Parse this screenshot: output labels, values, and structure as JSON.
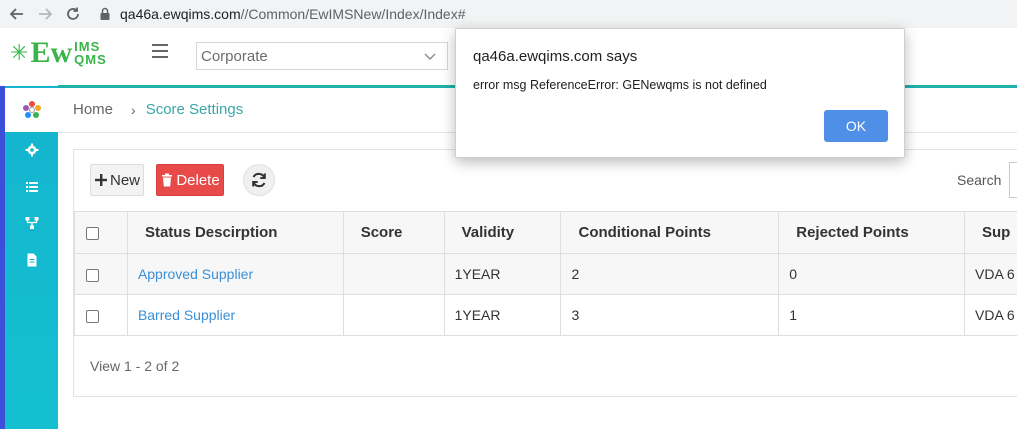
{
  "browser": {
    "url_host": "qa46a.ewqims.com",
    "url_path": "//Common/EwIMSNew/Index/Index#"
  },
  "header": {
    "logo_main": "Ew",
    "logo_top": "IMS",
    "logo_bottom": "QMS",
    "org_selected": "Corporate"
  },
  "breadcrumb": {
    "home": "Home",
    "separator": "›",
    "current": "Score Settings"
  },
  "toolbar": {
    "new_label": "New",
    "delete_label": "Delete",
    "search_label": "Search"
  },
  "table": {
    "columns": [
      "Status Descirption",
      "Score",
      "Validity",
      "Conditional Points",
      "Rejected Points",
      "Sup"
    ],
    "rows": [
      {
        "status": "Approved Supplier",
        "score": "",
        "validity": "1YEAR",
        "conditional": "2",
        "rejected": "0",
        "sup": "VDA 6"
      },
      {
        "status": "Barred Supplier",
        "score": "",
        "validity": "1YEAR",
        "conditional": "3",
        "rejected": "1",
        "sup": "VDA 6"
      }
    ]
  },
  "pager": {
    "text": "View 1 - 2 of 2"
  },
  "dialog": {
    "title": "qa46a.ewqims.com says",
    "message": "error msg ReferenceError: GENewqms is not defined",
    "ok_label": "OK"
  },
  "sidebar": {
    "items": [
      "settings-icon",
      "list-icon",
      "hierarchy-icon",
      "document-icon"
    ]
  },
  "colors": {
    "accent": "#20b2aa",
    "sidebar": "#14b4cf",
    "delete": "#e84a4a",
    "link": "#3a8fd6",
    "ok_button": "#4f8fe8"
  }
}
